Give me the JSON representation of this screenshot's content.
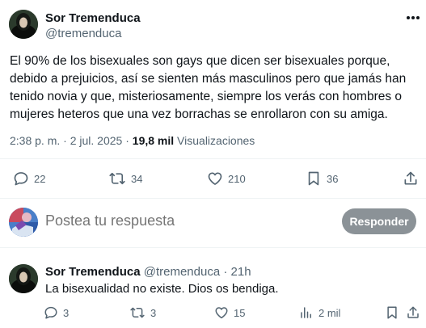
{
  "tweet": {
    "author_name": "Sor Tremenduca",
    "author_handle": "@tremenduca",
    "lines": [
      "El 90% de los bisexuales son gays que dicen ser bisexuales porque,",
      "debido a prejuicios, así se sienten más masculinos pero que jamás han",
      "tenido novia y que, misteriosamente, siempre los verás con hombres o",
      "mujeres heteros que una vez borrachas se enrollaron con su amiga."
    ],
    "time": "2:38 p. m.",
    "separator": "·",
    "date": "2 jul. 2025",
    "views_count": "19,8 mil",
    "views_label": "Visualizaciones",
    "actions": {
      "replies": "22",
      "retweets": "34",
      "likes": "210",
      "bookmarks": "36"
    }
  },
  "reply_box": {
    "placeholder": "Postea tu respuesta",
    "button_label": "Responder"
  },
  "reply": {
    "author_name": "Sor Tremenduca",
    "author_handle": "@tremenduca",
    "separator": "·",
    "time": "21h",
    "text": "La bisexualidad no existe. Dios os bendiga.",
    "actions": {
      "replies": "3",
      "retweets": "3",
      "likes": "15",
      "views": "2 mil"
    }
  },
  "colors": {
    "text_primary": "#0f1419",
    "text_secondary": "#536471",
    "divider": "#eff3f4",
    "button_disabled": "#8b9297"
  }
}
